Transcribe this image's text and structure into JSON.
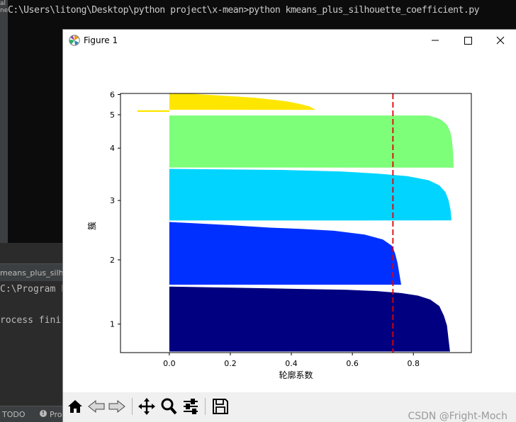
{
  "terminal": {
    "command_line": "C:\\Users\\litong\\Desktop\\python project\\x-mean>python kmeans_plus_silhouette_coefficient.py",
    "left_strip_text": "al\nne"
  },
  "ide": {
    "run_tab": "means_plus_silh",
    "console_lines": [
      "C:\\Program F",
      "",
      "rocess fini"
    ],
    "status_todo": "TODO",
    "status_problems": "Pro"
  },
  "window": {
    "title": "Figure 1"
  },
  "toolbar": {
    "buttons": [
      "home-icon",
      "back-icon",
      "forward-icon",
      "pan-icon",
      "zoom-icon",
      "configure-subplots-icon",
      "save-icon"
    ],
    "watermark": "CSDN @Fright-Moch"
  },
  "chart_data": {
    "type": "bar",
    "orientation": "horizontal",
    "xlabel": "轮廓系数",
    "ylabel": "簇",
    "xlim": [
      -0.16,
      0.99
    ],
    "ylim": [
      0,
      1
    ],
    "xticks": [
      "0.0",
      "0.2",
      "0.4",
      "0.6",
      "0.8"
    ],
    "xtick_values": [
      0.0,
      0.2,
      0.4,
      0.6,
      0.8
    ],
    "yticks": [
      "1",
      "2",
      "3",
      "4",
      "5",
      "6"
    ],
    "ytick_positions": [
      0.11,
      0.358,
      0.587,
      0.789,
      0.918,
      0.996
    ],
    "threshold_line": {
      "x": 0.733,
      "color": "#e00000",
      "style": "dashed"
    },
    "series": [
      {
        "name": "1",
        "color": "#000080",
        "ymin": 0.004,
        "ymax": 0.255,
        "profile": [
          [
            0,
            0.92
          ],
          [
            0.2,
            0.915
          ],
          [
            0.4,
            0.91
          ],
          [
            0.55,
            0.9
          ],
          [
            0.7,
            0.885
          ],
          [
            0.8,
            0.855
          ],
          [
            0.86,
            0.815
          ],
          [
            0.9,
            0.76
          ],
          [
            0.93,
            0.68
          ],
          [
            0.95,
            0.58
          ],
          [
            0.96,
            0.45
          ],
          [
            0.975,
            0.3
          ],
          [
            1,
            0.0
          ]
        ]
      },
      {
        "name": "2",
        "color": "#0030ff",
        "ymin": 0.262,
        "ymax": 0.504,
        "profile": [
          [
            0,
            0.76
          ],
          [
            0.15,
            0.755
          ],
          [
            0.35,
            0.748
          ],
          [
            0.5,
            0.74
          ],
          [
            0.62,
            0.73
          ],
          [
            0.72,
            0.7
          ],
          [
            0.8,
            0.64
          ],
          [
            0.86,
            0.54
          ],
          [
            0.89,
            0.43
          ],
          [
            0.91,
            0.33
          ],
          [
            0.95,
            0.2
          ],
          [
            1,
            0.0
          ]
        ]
      },
      {
        "name": "3",
        "color": "#00d4ff",
        "ymin": 0.51,
        "ymax": 0.709,
        "profile": [
          [
            0,
            0.925
          ],
          [
            0.2,
            0.922
          ],
          [
            0.4,
            0.915
          ],
          [
            0.55,
            0.905
          ],
          [
            0.68,
            0.885
          ],
          [
            0.78,
            0.85
          ],
          [
            0.86,
            0.78
          ],
          [
            0.91,
            0.68
          ],
          [
            0.95,
            0.56
          ],
          [
            0.98,
            0.37
          ],
          [
            1,
            0.0
          ]
        ]
      },
      {
        "name": "4",
        "color": "#7dff7a",
        "ymin": 0.714,
        "ymax": 0.915,
        "profile": [
          [
            0,
            0.932
          ],
          [
            0.3,
            0.93
          ],
          [
            0.55,
            0.926
          ],
          [
            0.7,
            0.92
          ],
          [
            0.82,
            0.91
          ],
          [
            0.9,
            0.895
          ],
          [
            0.95,
            0.88
          ],
          [
            0.98,
            0.86
          ],
          [
            1,
            0.85
          ]
        ]
      },
      {
        "name": "5",
        "color": "#ffe600",
        "ymin": 0.929,
        "ymax": 0.935,
        "profile": [
          [
            0,
            -0.105
          ],
          [
            1,
            -0.105
          ]
        ]
      },
      {
        "name": "6",
        "color": "#ffe600",
        "ymin": 0.937,
        "ymax": 1.0,
        "profile": [
          [
            0,
            0.48
          ],
          [
            0.2,
            0.46
          ],
          [
            0.35,
            0.43
          ],
          [
            0.5,
            0.39
          ],
          [
            0.62,
            0.34
          ],
          [
            0.74,
            0.28
          ],
          [
            0.84,
            0.2
          ],
          [
            0.92,
            0.12
          ],
          [
            1,
            0.06
          ]
        ]
      }
    ]
  }
}
